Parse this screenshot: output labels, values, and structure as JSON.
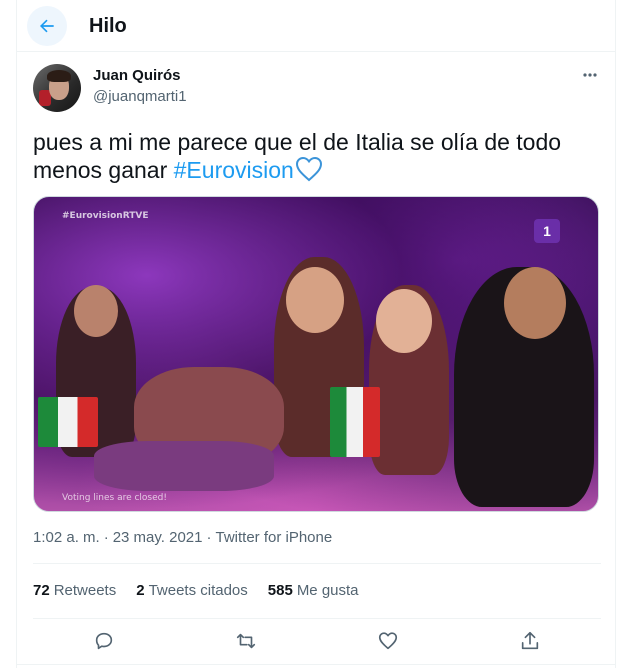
{
  "header": {
    "title": "Hilo"
  },
  "author": {
    "display_name": "Juan Quirós",
    "handle": "@juanqmarti1"
  },
  "tweet": {
    "text_line1": "pues a mi me parece que el de Italia se olía de todo",
    "text_line2": "menos ganar ",
    "hashtag": "#Eurovision",
    "media": {
      "brand_label": "#EurovisionRTVE",
      "channel_label": "1",
      "caption": "Voting lines are closed!"
    }
  },
  "meta": {
    "time": "1:02 a. m.",
    "date": "23 may. 2021",
    "source": "Twitter for iPhone"
  },
  "stats": {
    "retweets_count": "72",
    "retweets_label": "Retweets",
    "quotes_count": "2",
    "quotes_label": "Tweets citados",
    "likes_count": "585",
    "likes_label": "Me gusta"
  },
  "colors": {
    "accent": "#1d9bf0",
    "text": "#0f1419",
    "muted": "#536471",
    "border": "#eff3f4"
  }
}
